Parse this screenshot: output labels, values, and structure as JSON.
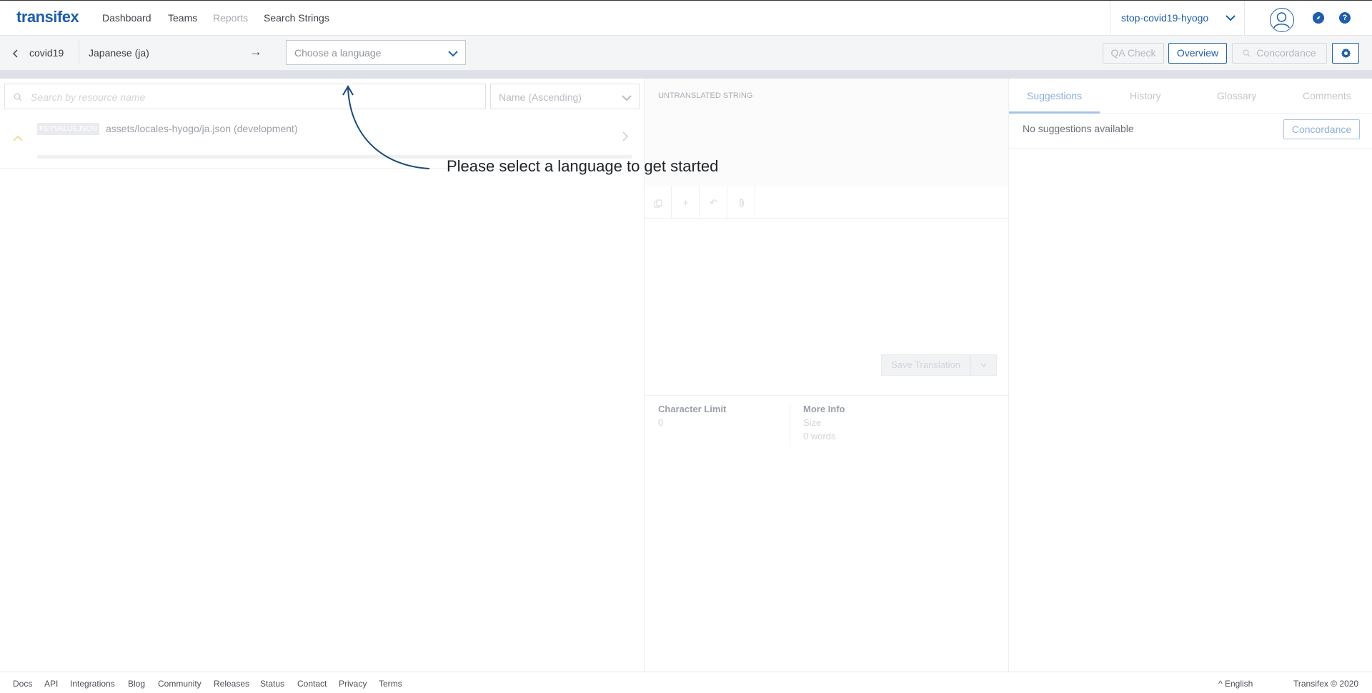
{
  "brand": {
    "logo": "transifex",
    "color": "#1f5ea8"
  },
  "nav": {
    "items": [
      {
        "label": "Dashboard",
        "disabled": false
      },
      {
        "label": "Teams",
        "disabled": false
      },
      {
        "label": "Reports",
        "disabled": true
      },
      {
        "label": "Search Strings",
        "disabled": false
      }
    ]
  },
  "project_selector": {
    "value": "stop-covid19-hyogo",
    "icon": "chevron-down-icon"
  },
  "header_icons": {
    "avatar": "user-avatar-icon",
    "compass": "compass-icon",
    "help": "help-icon"
  },
  "subbar": {
    "back_label": "covid19",
    "source_language": "Japanese (ja)",
    "arrow": "→",
    "language_select": {
      "placeholder": "Choose a language",
      "value": ""
    },
    "buttons": {
      "qa_check": "QA Check",
      "overview": "Overview",
      "concordance": "Concordance"
    }
  },
  "left_pane": {
    "search_placeholder": "Search by resource name",
    "sort": "Name (Ascending)",
    "resources": [
      {
        "badge": "KEYVALUEJSON",
        "name": "assets/locales-hyogo/ja.json (development)",
        "progress": 0
      }
    ]
  },
  "editor": {
    "status_label": "UNTRANSLATED STRING",
    "tools": [
      "copy-icon",
      "plus-icon",
      "undo-icon",
      "attachment-icon"
    ],
    "save_label": "Save Translation",
    "char_limit_label": "Character Limit",
    "char_limit_value": "0",
    "more_info_label": "More Info",
    "size_label": "Size",
    "words_label": "0 words"
  },
  "right_panel": {
    "tabs": [
      "Suggestions",
      "History",
      "Glossary",
      "Comments"
    ],
    "active_tab": "Suggestions",
    "no_suggestions": "No suggestions available",
    "concordance_label": "Concordance"
  },
  "overlay": {
    "message": "Please select a language to get started"
  },
  "footer": {
    "links": [
      "Docs",
      "API",
      "Integrations",
      "Blog",
      "Community",
      "Releases",
      "Status",
      "Contact",
      "Privacy",
      "Terms"
    ],
    "language": "English",
    "language_caret": "^",
    "copyright": "Transifex © 2020"
  }
}
